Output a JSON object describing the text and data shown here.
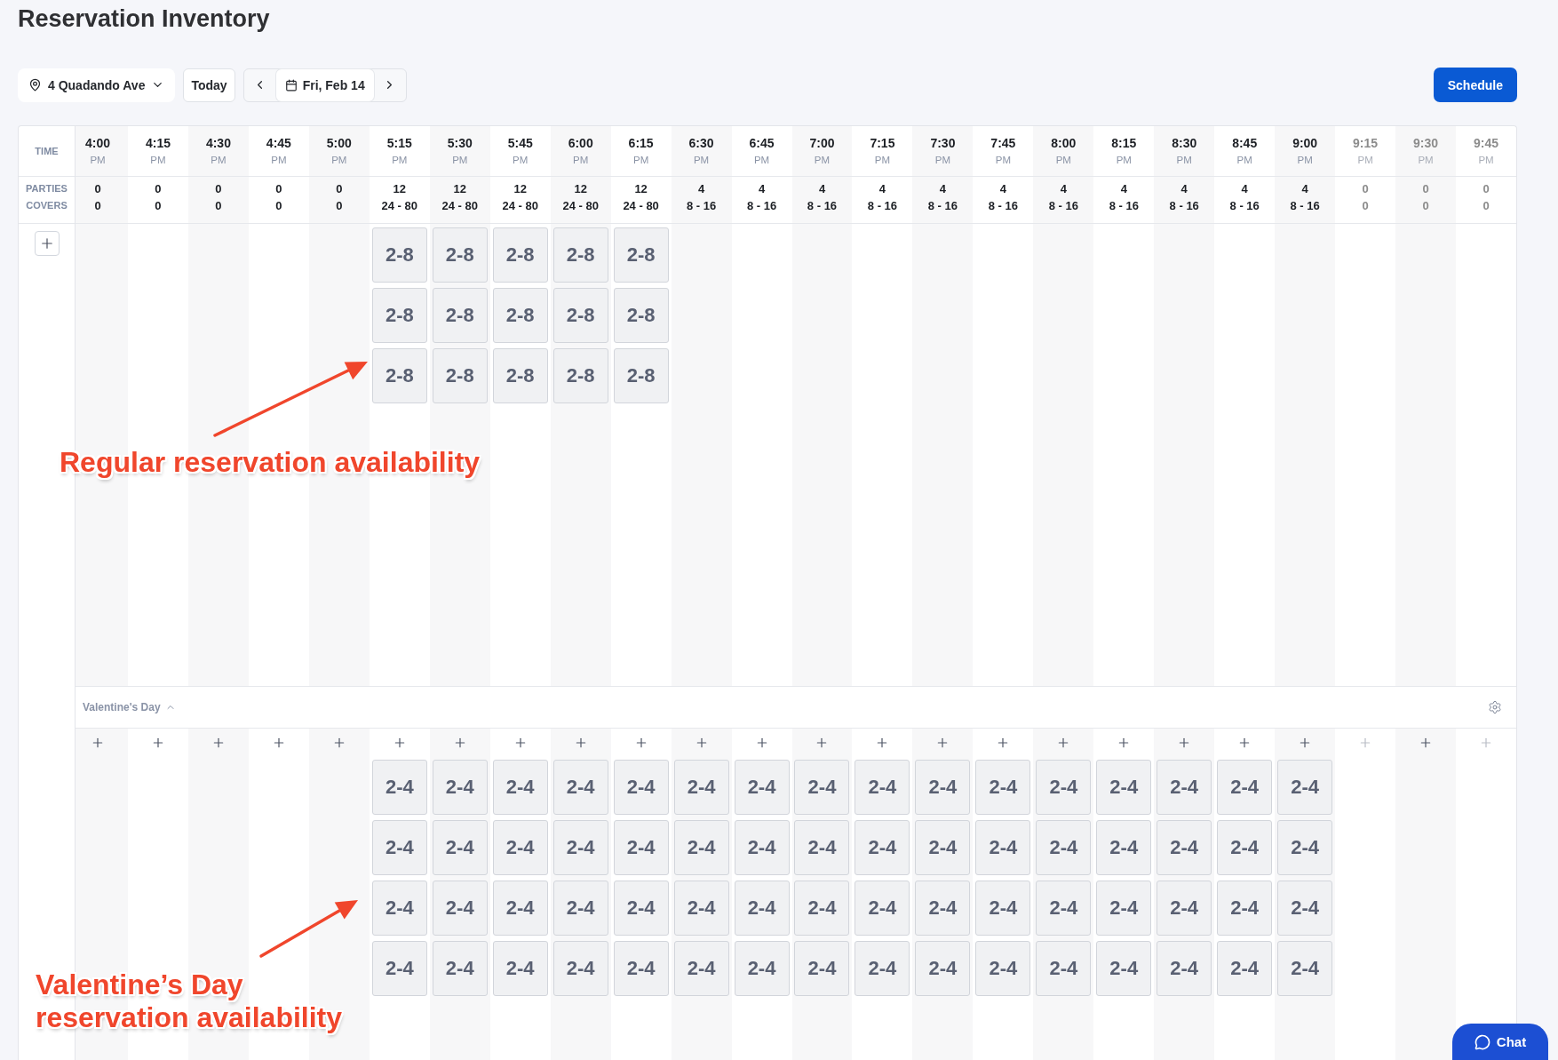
{
  "title": "Reservation Inventory",
  "toolbar": {
    "location": "4 Quadando Ave",
    "today": "Today",
    "date": "Fri, Feb 14",
    "schedule": "Schedule"
  },
  "grid": {
    "row_labels": {
      "time": "TIME",
      "parties": "PARTIES",
      "covers": "COVERS"
    },
    "columns": [
      {
        "time": "4:00",
        "period": "PM",
        "parties": "0",
        "covers": "0",
        "disabled": false
      },
      {
        "time": "4:15",
        "period": "PM",
        "parties": "0",
        "covers": "0",
        "disabled": false
      },
      {
        "time": "4:30",
        "period": "PM",
        "parties": "0",
        "covers": "0",
        "disabled": false
      },
      {
        "time": "4:45",
        "period": "PM",
        "parties": "0",
        "covers": "0",
        "disabled": false
      },
      {
        "time": "5:00",
        "period": "PM",
        "parties": "0",
        "covers": "0",
        "disabled": false
      },
      {
        "time": "5:15",
        "period": "PM",
        "parties": "12",
        "covers": "24 - 80",
        "disabled": false,
        "slots": [
          "2-8",
          "2-8",
          "2-8"
        ]
      },
      {
        "time": "5:30",
        "period": "PM",
        "parties": "12",
        "covers": "24 - 80",
        "disabled": false,
        "slots": [
          "2-8",
          "2-8",
          "2-8"
        ]
      },
      {
        "time": "5:45",
        "period": "PM",
        "parties": "12",
        "covers": "24 - 80",
        "disabled": false,
        "slots": [
          "2-8",
          "2-8",
          "2-8"
        ]
      },
      {
        "time": "6:00",
        "period": "PM",
        "parties": "12",
        "covers": "24 - 80",
        "disabled": false,
        "slots": [
          "2-8",
          "2-8",
          "2-8"
        ]
      },
      {
        "time": "6:15",
        "period": "PM",
        "parties": "12",
        "covers": "24 - 80",
        "disabled": false,
        "slots": [
          "2-8",
          "2-8",
          "2-8"
        ]
      },
      {
        "time": "6:30",
        "period": "PM",
        "parties": "4",
        "covers": "8 - 16",
        "disabled": false
      },
      {
        "time": "6:45",
        "period": "PM",
        "parties": "4",
        "covers": "8 - 16",
        "disabled": false
      },
      {
        "time": "7:00",
        "period": "PM",
        "parties": "4",
        "covers": "8 - 16",
        "disabled": false
      },
      {
        "time": "7:15",
        "period": "PM",
        "parties": "4",
        "covers": "8 - 16",
        "disabled": false
      },
      {
        "time": "7:30",
        "period": "PM",
        "parties": "4",
        "covers": "8 - 16",
        "disabled": false
      },
      {
        "time": "7:45",
        "period": "PM",
        "parties": "4",
        "covers": "8 - 16",
        "disabled": false
      },
      {
        "time": "8:00",
        "period": "PM",
        "parties": "4",
        "covers": "8 - 16",
        "disabled": false
      },
      {
        "time": "8:15",
        "period": "PM",
        "parties": "4",
        "covers": "8 - 16",
        "disabled": false
      },
      {
        "time": "8:30",
        "period": "PM",
        "parties": "4",
        "covers": "8 - 16",
        "disabled": false
      },
      {
        "time": "8:45",
        "period": "PM",
        "parties": "4",
        "covers": "8 - 16",
        "disabled": false
      },
      {
        "time": "9:00",
        "period": "PM",
        "parties": "4",
        "covers": "8 - 16",
        "disabled": false
      },
      {
        "time": "9:15",
        "period": "PM",
        "parties": "0",
        "covers": "0",
        "disabled": true
      },
      {
        "time": "9:30",
        "period": "PM",
        "parties": "0",
        "covers": "0",
        "disabled": true
      },
      {
        "time": "9:45",
        "period": "PM",
        "parties": "0",
        "covers": "0",
        "disabled": true
      }
    ]
  },
  "sections": [
    {
      "title": "Valentine's Day",
      "expanded": true,
      "columns": [
        {
          "add_disabled": false
        },
        {
          "add_disabled": false
        },
        {
          "add_disabled": false
        },
        {
          "add_disabled": false
        },
        {
          "add_disabled": false
        },
        {
          "add_disabled": false,
          "slots": [
            "2-4",
            "2-4",
            "2-4",
            "2-4"
          ]
        },
        {
          "add_disabled": false,
          "slots": [
            "2-4",
            "2-4",
            "2-4",
            "2-4"
          ]
        },
        {
          "add_disabled": false,
          "slots": [
            "2-4",
            "2-4",
            "2-4",
            "2-4"
          ]
        },
        {
          "add_disabled": false,
          "slots": [
            "2-4",
            "2-4",
            "2-4",
            "2-4"
          ]
        },
        {
          "add_disabled": false,
          "slots": [
            "2-4",
            "2-4",
            "2-4",
            "2-4"
          ]
        },
        {
          "add_disabled": false,
          "slots": [
            "2-4",
            "2-4",
            "2-4",
            "2-4"
          ]
        },
        {
          "add_disabled": false,
          "slots": [
            "2-4",
            "2-4",
            "2-4",
            "2-4"
          ]
        },
        {
          "add_disabled": false,
          "slots": [
            "2-4",
            "2-4",
            "2-4",
            "2-4"
          ]
        },
        {
          "add_disabled": false,
          "slots": [
            "2-4",
            "2-4",
            "2-4",
            "2-4"
          ]
        },
        {
          "add_disabled": false,
          "slots": [
            "2-4",
            "2-4",
            "2-4",
            "2-4"
          ]
        },
        {
          "add_disabled": false,
          "slots": [
            "2-4",
            "2-4",
            "2-4",
            "2-4"
          ]
        },
        {
          "add_disabled": false,
          "slots": [
            "2-4",
            "2-4",
            "2-4",
            "2-4"
          ]
        },
        {
          "add_disabled": false,
          "slots": [
            "2-4",
            "2-4",
            "2-4",
            "2-4"
          ]
        },
        {
          "add_disabled": false,
          "slots": [
            "2-4",
            "2-4",
            "2-4",
            "2-4"
          ]
        },
        {
          "add_disabled": false,
          "slots": [
            "2-4",
            "2-4",
            "2-4",
            "2-4"
          ]
        },
        {
          "add_disabled": false,
          "slots": [
            "2-4",
            "2-4",
            "2-4",
            "2-4"
          ]
        },
        {
          "add_disabled": true
        },
        {
          "add_disabled": false
        },
        {
          "add_disabled": true
        }
      ]
    }
  ],
  "annotations": [
    {
      "text": "Regular reservation availability"
    },
    {
      "text": "Valentine’s Day reservation availability"
    }
  ],
  "chat": "Chat"
}
